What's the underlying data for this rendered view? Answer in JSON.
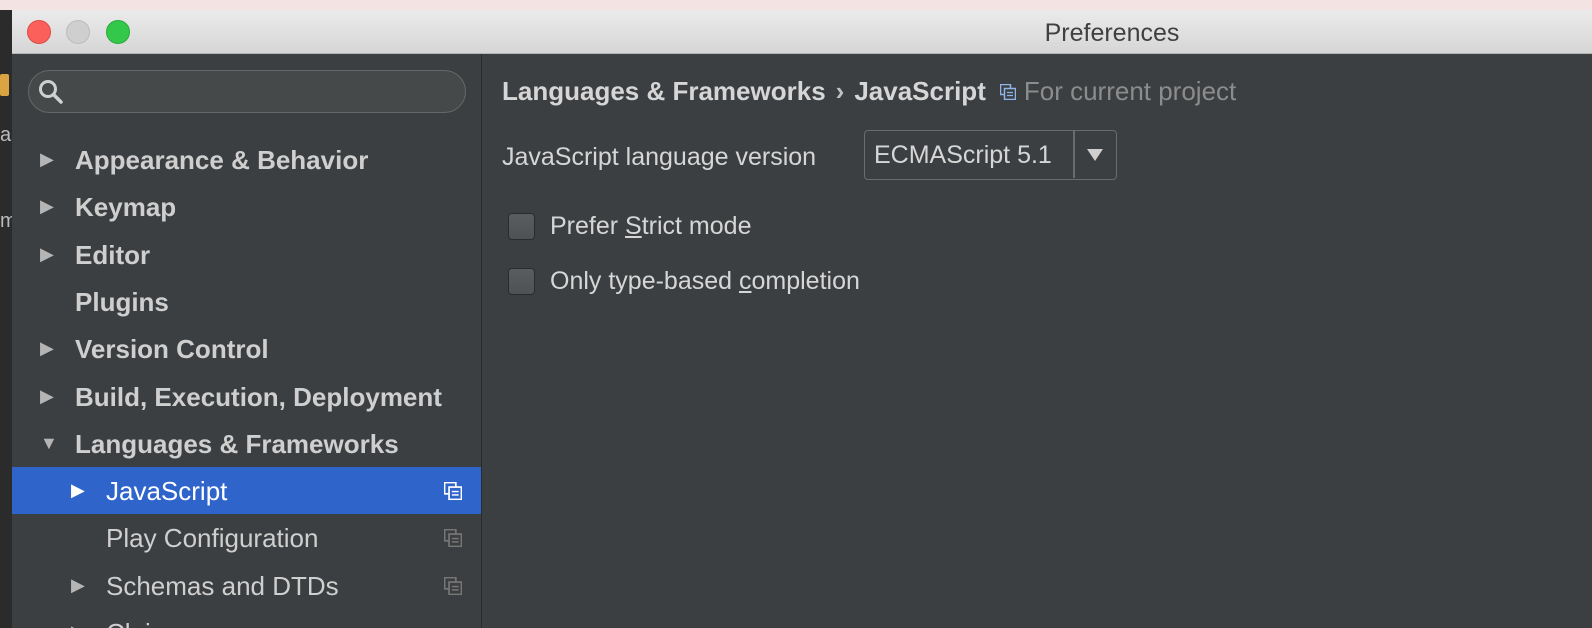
{
  "window": {
    "title": "Preferences"
  },
  "background_fragments": [
    "a",
    "m"
  ],
  "search": {
    "placeholder": "",
    "value": ""
  },
  "sidebar": {
    "items": [
      {
        "label": "Appearance & Behavior",
        "level": 0,
        "expandable": true,
        "expanded": false,
        "selected": false,
        "project_scoped": false
      },
      {
        "label": "Keymap",
        "level": 0,
        "expandable": true,
        "expanded": false,
        "selected": false,
        "project_scoped": false
      },
      {
        "label": "Editor",
        "level": 0,
        "expandable": true,
        "expanded": false,
        "selected": false,
        "project_scoped": false
      },
      {
        "label": "Plugins",
        "level": 0,
        "expandable": false,
        "expanded": false,
        "selected": false,
        "project_scoped": false
      },
      {
        "label": "Version Control",
        "level": 0,
        "expandable": true,
        "expanded": false,
        "selected": false,
        "project_scoped": false
      },
      {
        "label": "Build, Execution, Deployment",
        "level": 0,
        "expandable": true,
        "expanded": false,
        "selected": false,
        "project_scoped": false
      },
      {
        "label": "Languages & Frameworks",
        "level": 0,
        "expandable": true,
        "expanded": true,
        "selected": false,
        "project_scoped": false
      },
      {
        "label": "JavaScript",
        "level": 1,
        "expandable": true,
        "expanded": false,
        "selected": true,
        "project_scoped": true
      },
      {
        "label": "Play Configuration",
        "level": 1,
        "expandable": false,
        "expanded": false,
        "selected": false,
        "project_scoped": true
      },
      {
        "label": "Schemas and DTDs",
        "level": 1,
        "expandable": true,
        "expanded": false,
        "selected": false,
        "project_scoped": true
      },
      {
        "label": "Clojure",
        "level": 1,
        "expandable": true,
        "expanded": false,
        "selected": false,
        "project_scoped": false
      }
    ]
  },
  "breadcrumb": {
    "parent": "Languages & Frameworks",
    "separator": "›",
    "current": "JavaScript",
    "scope_label": "For current project"
  },
  "settings": {
    "language_version_label": "JavaScript language version",
    "language_version_value": "ECMAScript 5.1",
    "strict_mode": {
      "before": "Prefer ",
      "mnemonic": "S",
      "after": "trict mode",
      "checked": false
    },
    "type_completion": {
      "before": "Only type-based ",
      "mnemonic": "c",
      "after": "ompletion",
      "checked": false
    }
  },
  "colors": {
    "panel_bg": "#3c3f41",
    "selection_bg": "#2f65ca",
    "text": "#d6d6d6",
    "muted_text": "#8c8c8c"
  },
  "icons": {
    "search": "search-icon",
    "expand": "triangle-right-icon",
    "collapse": "triangle-down-icon",
    "project_scope": "project-settings-icon",
    "dropdown": "chevron-down-icon"
  }
}
